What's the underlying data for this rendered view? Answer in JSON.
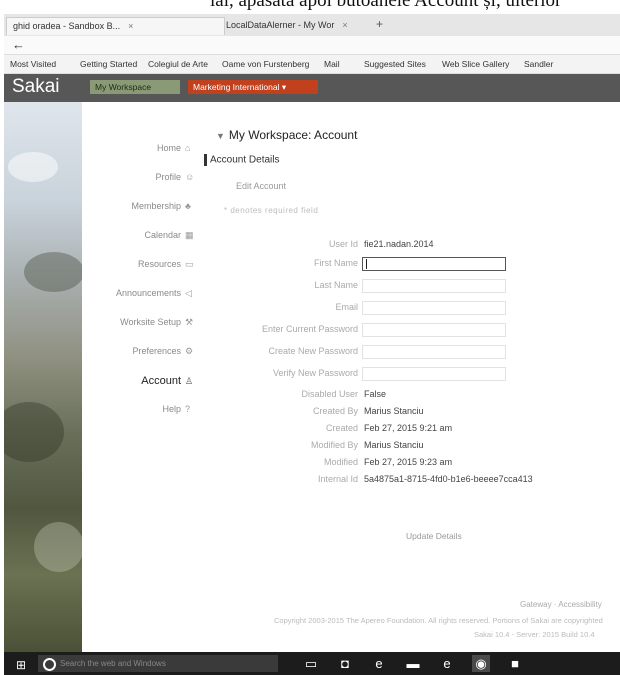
{
  "caption": "ial, apăsată apoi butoanele Account și, ulterior",
  "browser": {
    "tabs": [
      {
        "label": "ghid oradea - Sandbox B...",
        "close": "×"
      },
      {
        "label": "LocalDataAlerner - My Wor",
        "close": "×"
      }
    ],
    "new_tab": "+",
    "back": "←",
    "url": ""
  },
  "bookmarks": [
    "Most Visited",
    "Getting Started",
    "Colegiul de Arte",
    "Oame von Furstenberg",
    "Mail",
    "Suggested Sites",
    "Web Slice Gallery",
    "Sandler"
  ],
  "sakai": {
    "logo": "Sakai",
    "sites": [
      "My Workspace",
      "Marketing International ▾"
    ]
  },
  "tools": [
    {
      "label": "Home",
      "icon": "house-icon"
    },
    {
      "label": "Profile",
      "icon": "person-icon"
    },
    {
      "label": "Membership",
      "icon": "group-icon"
    },
    {
      "label": "Calendar",
      "icon": "calendar-icon"
    },
    {
      "label": "Resources",
      "icon": "folder-icon"
    },
    {
      "label": "Announcements",
      "icon": "megaphone-icon"
    },
    {
      "label": "Worksite Setup",
      "icon": "wrench-icon"
    },
    {
      "label": "Preferences",
      "icon": "gear-icon"
    },
    {
      "label": "Account",
      "icon": "account-icon",
      "active": true
    },
    {
      "label": "Help",
      "icon": "help-icon"
    }
  ],
  "main": {
    "page_title": "My Workspace: Account",
    "section_title": "Account Details",
    "edit_link": "Edit Account",
    "hint": "* denotes required field",
    "rows": [
      {
        "label": "User Id",
        "value": "fie21.nadan.2014",
        "kind": "text"
      },
      {
        "label": "First Name",
        "value": "",
        "kind": "input-focus"
      },
      {
        "label": "Last Name",
        "value": "",
        "kind": "input"
      },
      {
        "label": "Email",
        "value": "",
        "kind": "input"
      },
      {
        "label": "Enter Current Password",
        "value": "",
        "kind": "input"
      },
      {
        "label": "Create New Password",
        "value": "",
        "kind": "input"
      },
      {
        "label": "Verify New Password",
        "value": "",
        "kind": "input"
      },
      {
        "label": "Disabled User",
        "value": "False",
        "kind": "text"
      },
      {
        "label": "Created By",
        "value": "Marius Stanciu",
        "kind": "text"
      },
      {
        "label": "Created",
        "value": "Feb 27, 2015 9:21 am",
        "kind": "text"
      },
      {
        "label": "Modified By",
        "value": "Marius Stanciu",
        "kind": "text"
      },
      {
        "label": "Modified",
        "value": "Feb 27, 2015 9:23 am",
        "kind": "text"
      },
      {
        "label": "Internal Id",
        "value": "5a4875a1-8715-4fd0-b1e6-beeee7cca413",
        "kind": "text"
      }
    ],
    "update_button": "Update Details"
  },
  "footer": {
    "links": "Gateway  ·  Accessibility",
    "copyright": "Copyright 2003-2015 The Apereo Foundation. All rights reserved. Portions of Sakai are copyrighted",
    "build": "Sakai 10.4 - Server: 2015 Build 10.4"
  },
  "taskbar": {
    "search_placeholder": "Search the web and Windows"
  }
}
